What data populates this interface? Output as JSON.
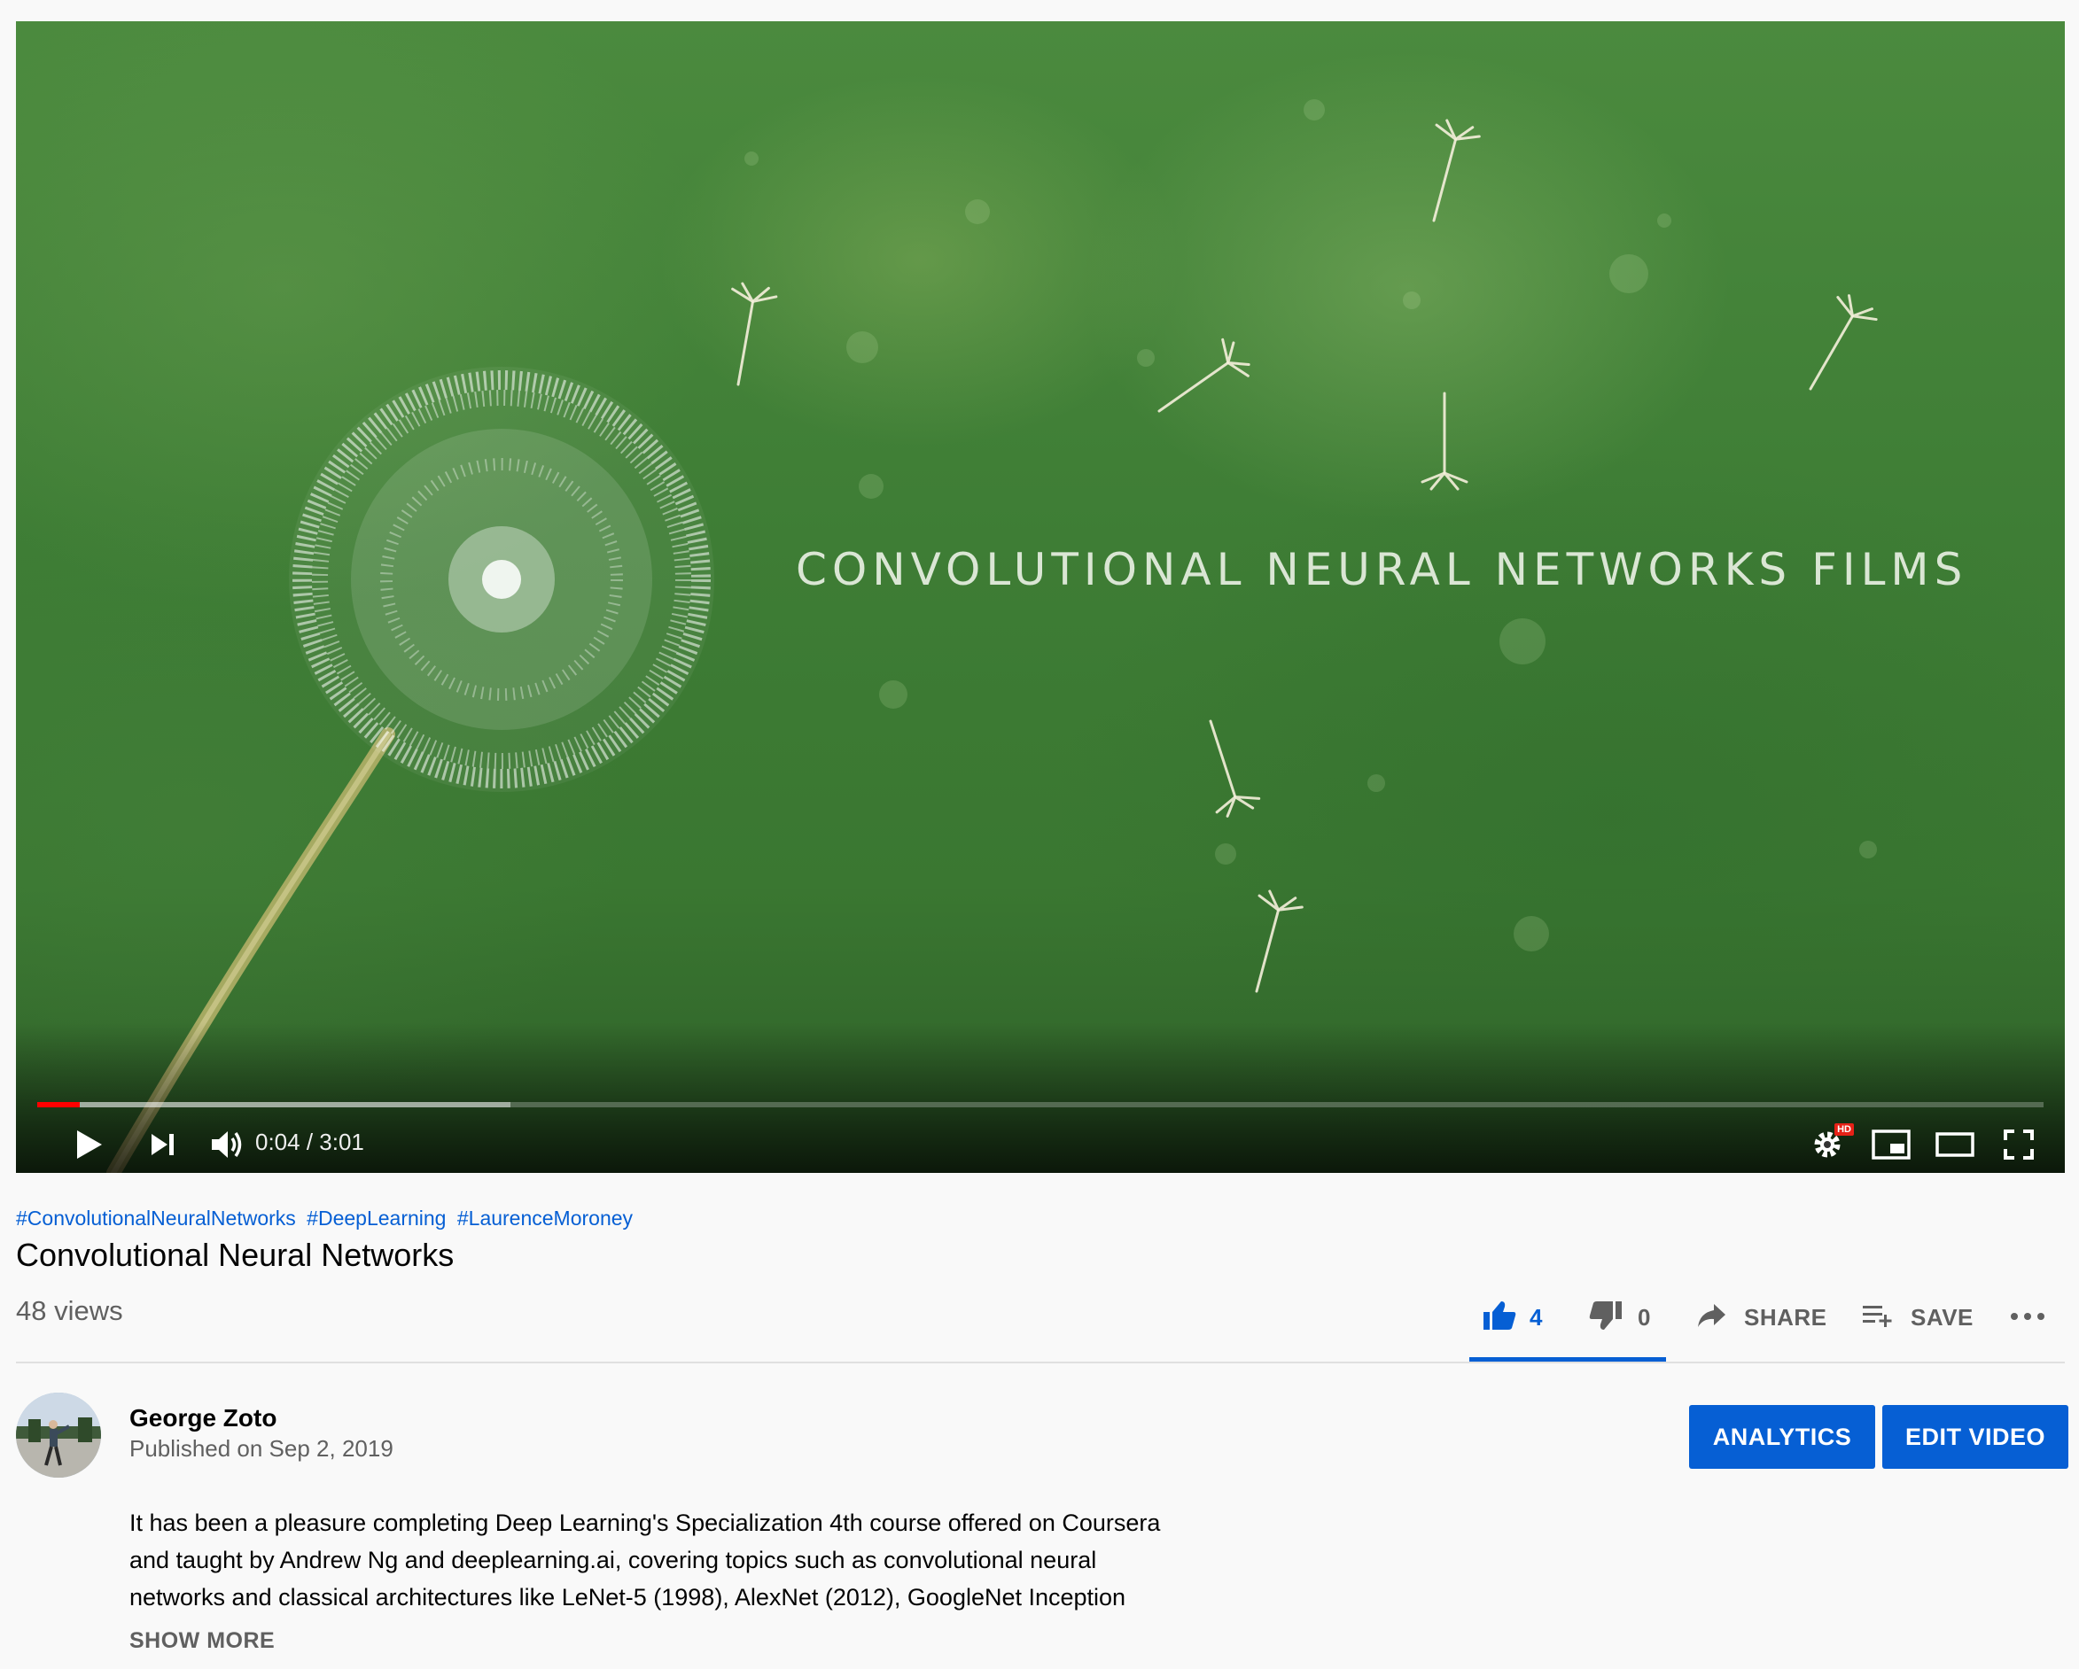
{
  "video": {
    "overlay_title": "CONVOLUTIONAL NEURAL NETWORKS FILMS",
    "time_display": "0:04 / 3:01",
    "played_fraction": 0.021,
    "buffered_fraction": 0.236,
    "controls": {
      "play_icon": "play-icon",
      "next_icon": "next-icon",
      "volume_icon": "volume-icon",
      "settings_icon": "settings-icon",
      "settings_badge": "HD",
      "miniplayer_icon": "miniplayer-icon",
      "theater_icon": "theater-icon",
      "fullscreen_icon": "fullscreen-icon"
    },
    "progress_color": "#ff0000"
  },
  "info": {
    "hashtags": [
      "#ConvolutionalNeuralNetworks",
      "#DeepLearning",
      "#LaurenceMoroney"
    ],
    "title": "Convolutional Neural Networks",
    "views": "48 views",
    "actions": {
      "likes": "4",
      "dislikes": "0",
      "share_label": "SHARE",
      "save_label": "SAVE"
    },
    "accent_color": "#065fd4"
  },
  "channel": {
    "name": "George Zoto",
    "published": "Published on Sep 2, 2019",
    "analytics_label": "ANALYTICS",
    "edit_label": "EDIT VIDEO"
  },
  "description": {
    "lines": [
      "It has been a pleasure completing Deep Learning's Specialization 4th course offered on Coursera",
      "and taught by Andrew Ng and deeplearning.ai, covering topics such as convolutional neural",
      "networks and classical architectures like LeNet-5 (1998), AlexNet (2012), GoogleNet Inception"
    ],
    "show_more_label": "SHOW MORE"
  }
}
